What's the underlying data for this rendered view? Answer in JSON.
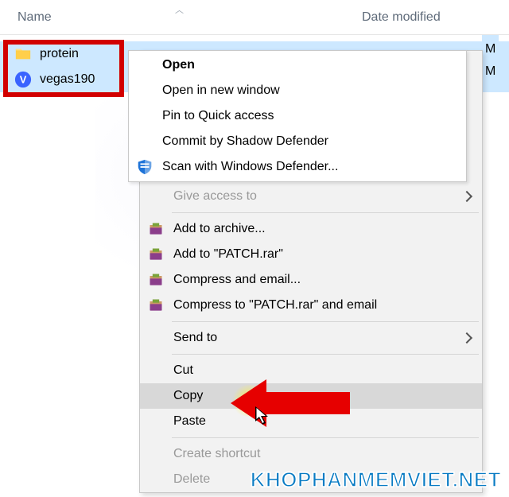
{
  "columns": {
    "name": "Name",
    "date": "Date modified"
  },
  "files": [
    {
      "name": "protein",
      "icon": "folder"
    },
    {
      "name": "vegas190",
      "icon": "vegas"
    }
  ],
  "date_peek": "M\nM",
  "context_menu": {
    "top": [
      {
        "label": "Open",
        "bold": true
      },
      {
        "label": "Open in new window"
      },
      {
        "label": "Pin to Quick access"
      },
      {
        "label": "Commit by Shadow Defender"
      },
      {
        "label": "Scan with Windows Defender...",
        "icon": "defender"
      }
    ],
    "main": [
      {
        "label": "Give access to",
        "arrow": true,
        "faded": true
      },
      {
        "sep": true
      },
      {
        "label": "Add to archive...",
        "icon": "winrar"
      },
      {
        "label": "Add to \"PATCH.rar\"",
        "icon": "winrar"
      },
      {
        "label": "Compress and email...",
        "icon": "winrar"
      },
      {
        "label": "Compress to \"PATCH.rar\" and email",
        "icon": "winrar"
      },
      {
        "sep": true
      },
      {
        "label": "Send to",
        "arrow": true
      },
      {
        "sep": true
      },
      {
        "label": "Cut"
      },
      {
        "label": "Copy",
        "highlight": true
      },
      {
        "label": "Paste"
      },
      {
        "sep": true
      },
      {
        "label": "Create shortcut",
        "faded": true
      },
      {
        "label": "Delete",
        "faded": true
      }
    ]
  },
  "watermark": "KhoPhanMemViet.Net",
  "colors": {
    "selection": "#cde8ff",
    "highlight_red": "#d20000",
    "accent": "#0a7cc4"
  }
}
